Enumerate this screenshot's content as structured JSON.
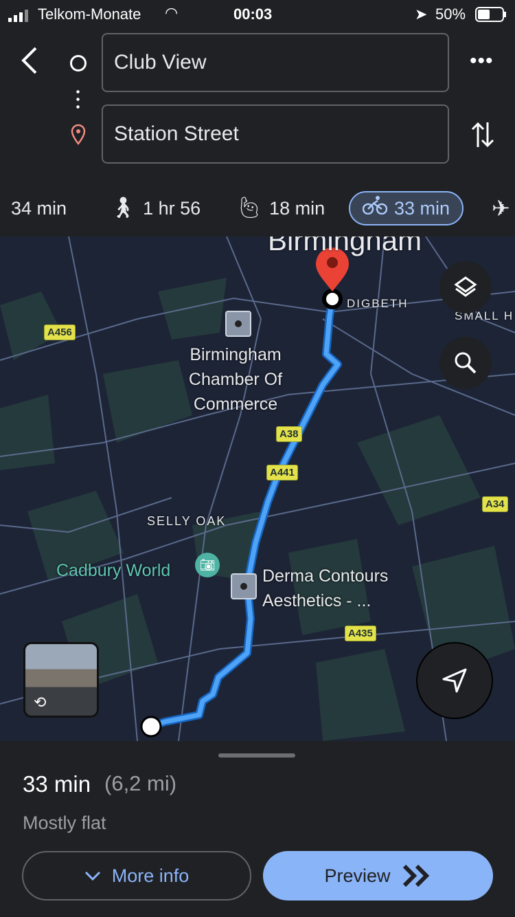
{
  "status": {
    "carrier": "Telkom-Monate",
    "time": "00:03",
    "battery": "50%"
  },
  "search": {
    "origin": "Club View",
    "destination": "Station Street"
  },
  "modes": [
    {
      "icon": "car-icon",
      "label": "34 min"
    },
    {
      "icon": "walk-icon",
      "label": "1 hr 56"
    },
    {
      "icon": "ride-hail-icon",
      "label": "18 min"
    },
    {
      "icon": "bicycle-icon",
      "label": "33 min",
      "selected": true
    },
    {
      "icon": "flight-icon",
      "label": ""
    }
  ],
  "map": {
    "city": "Birmingham",
    "area1": "DIGBETH",
    "area2": "SMALL H",
    "area3": "SELLY OAK",
    "poi1": "Birmingham Chamber Of Commerce",
    "poi2": "Cadbury World",
    "poi3a": "Derma Contours",
    "poi3b": "Aesthetics - ...",
    "roads": [
      "A456",
      "A38",
      "A441",
      "A34",
      "A435"
    ],
    "route_color": "#4fa3f7"
  },
  "sheet": {
    "duration": "33 min",
    "distance": "(6,2 mi)",
    "elevation": "Mostly flat",
    "more_info": "More info",
    "preview": "Preview"
  },
  "colors": {
    "accent": "#8ab4f8",
    "destination_pin": "#ea4335"
  }
}
